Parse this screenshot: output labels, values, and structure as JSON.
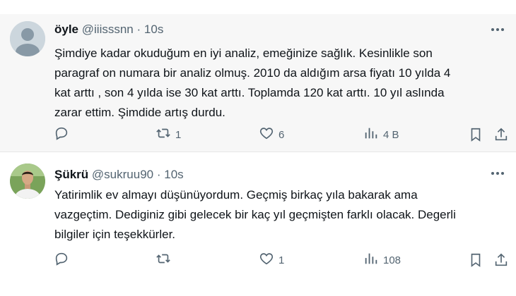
{
  "tweets": [
    {
      "name": "öyle",
      "handle": "@iiisssnn",
      "separator": "·",
      "time": "10s",
      "text": "Şimdiye kadar okuduğum en iyi analiz, emeğinize sağlık. Kesinlikle son\nparagraf on numara bir analiz olmuş. 2010 da aldığım arsa  fiyatı 10 yılda 4\nkat arttı , son 4 yılda ise 30 kat arttı. Toplamda 120 kat arttı. 10 yıl aslında\nzarar ettim. Şimdide artış durdu.",
      "replies": "",
      "retweets": "1",
      "likes": "6",
      "views": "4 B"
    },
    {
      "name": "Şükrü",
      "handle": "@sukruu90",
      "separator": "·",
      "time": "10s",
      "text": "Yatirimlik ev almayı düşünüyordum. Geçmiş birkaç yıla bakarak ama\nvazgeçtim.  Dediginiz gibi gelecek bir kaç yıl geçmişten farklı olacak. Degerli\nbilgiler için teşekkürler.",
      "replies": "",
      "retweets": "",
      "likes": "1",
      "views": "108"
    }
  ],
  "icons": {
    "reply": "reply-icon",
    "retweet": "retweet-icon",
    "like": "heart-icon",
    "views": "views-icon",
    "bookmark": "bookmark-icon",
    "share": "share-icon",
    "more": "more-icon"
  },
  "colors": {
    "text": "#0f1419",
    "muted": "#536471",
    "highlight_bg": "#f7f7f7"
  }
}
